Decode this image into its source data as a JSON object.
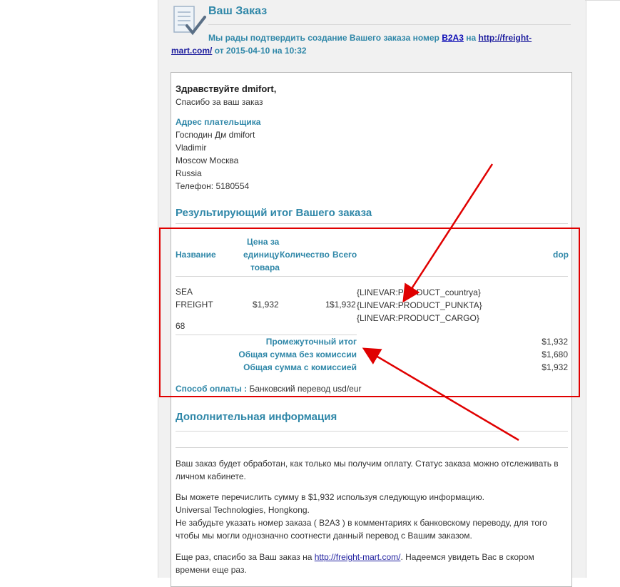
{
  "header": {
    "title": "Ваш Заказ",
    "confirm_pre": "Мы рады подтвердить создание Вашего заказа номер ",
    "order_number": "B2A3",
    "confirm_mid": " на ",
    "site_link": "http://freight-mart.com/",
    "confirm_post": " от 2015-04-10 на 10:32"
  },
  "greeting": "Здравствуйте dmifort,",
  "thanks": "Спасибо за ваш заказ",
  "billing": {
    "label": "Адрес плательщика",
    "lines": [
      "Господин Дм dmifort",
      "Vladimir",
      "Moscow Москва",
      "Russia",
      "Телефон: 5180554"
    ]
  },
  "summary_title": "Результирующий итог Вашего заказа",
  "table": {
    "headers": {
      "name": "Название",
      "price_1": "Цена за",
      "price_2": "единицу",
      "price_3": "товара",
      "qty": "Количество",
      "total": "Всего",
      "dop": "dop"
    },
    "row": {
      "name_1": "SEA",
      "name_2": "FREIGHT",
      "name_3": "68",
      "price": "$1,932",
      "qty": "1",
      "total": "$1,932",
      "var_1": "{LINEVAR:PRODUCT_countrya}",
      "var_2": "{LINEVAR:PRODUCT_PUNKTA}",
      "var_3": "{LINEVAR:PRODUCT_CARGO}"
    },
    "totals": [
      {
        "label": "Промежуточный итог",
        "value": "$1,932"
      },
      {
        "label": "Общая сумма без комиссии",
        "value": "$1,680"
      },
      {
        "label": "Общая сумма с комиссией",
        "value": "$1,932"
      }
    ],
    "payment_label": "Способ оплаты :",
    "payment_value": " Банковский перевод usd/eur"
  },
  "extra": {
    "title": "Дополнительная информация",
    "p1": "Ваш заказ будет обработан, как только мы получим оплату. Статус заказа можно отслеживать в личном кабинете.",
    "p2_1": "Вы можете перечислить сумму в $1,932 используя следующую информацию.",
    "p2_2": "Universal Technologies, Hongkong.",
    "p2_3": "Не забудьте указать номер заказа ( B2A3 ) в комментариях к банковскому переводу, для того чтобы мы могли однозначно соотнести данный перевод с Вашим заказом.",
    "p3_pre": "Еще раз, спасибо за Ваш заказ на ",
    "p3_link": "http://freight-mart.com/",
    "p3_post": ". Надеемся увидеть Вас в скором времени еще раз."
  },
  "annotation_color": "#e00000"
}
